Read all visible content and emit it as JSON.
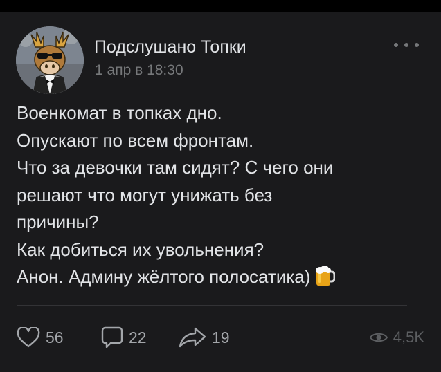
{
  "post": {
    "author": "Подслушано Топки",
    "date": "1 апр в 18:30",
    "lines": [
      "Военкомат в топках дно.",
      "Опускают по всем фронтам.",
      "Что за девочки там сидят? С чего они",
      "решают что могут унижать без",
      "причины?",
      "Как добиться их увольнения?",
      "Анон. Админу жёлтого полосатика)"
    ],
    "emoji_icon": "beer-mug-icon"
  },
  "actions": {
    "likes": "56",
    "comments": "22",
    "shares": "19",
    "views": "4,5K"
  },
  "colors": {
    "background": "#000000",
    "card": "#1a1a1c",
    "text": "#e1e3e6",
    "secondary": "#76787a",
    "icons": "#a3a6aa"
  }
}
